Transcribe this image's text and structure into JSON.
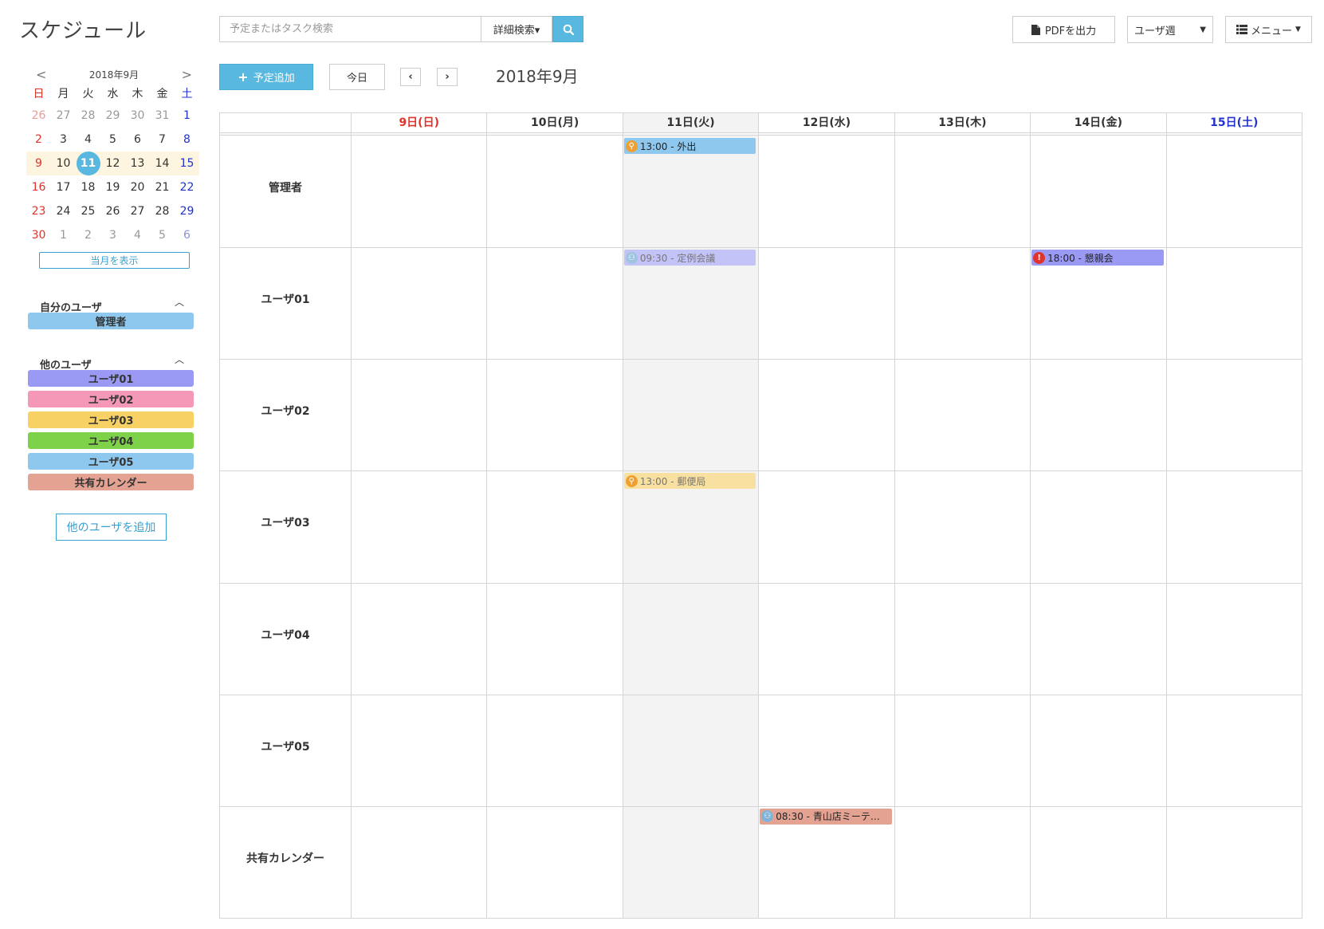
{
  "app": {
    "title": "スケジュール"
  },
  "search": {
    "placeholder": "予定またはタスク検索",
    "advanced_label": "詳細検索▾"
  },
  "toolbar": {
    "pdf_label": "PDFを出力",
    "view_selected": "ユーザ週",
    "menu_label": "メニュー",
    "add_label": "予定追加",
    "today_label": "今日",
    "prev_label": "‹",
    "next_label": "›",
    "current_month": "2018年9月"
  },
  "mini_calendar": {
    "title": "2018年9月",
    "prev": "<",
    "next": ">",
    "weekdays": [
      "日",
      "月",
      "火",
      "水",
      "木",
      "金",
      "土"
    ],
    "weeks": [
      [
        "26",
        "27",
        "28",
        "29",
        "30",
        "31",
        "1"
      ],
      [
        "2",
        "3",
        "4",
        "5",
        "6",
        "7",
        "8"
      ],
      [
        "9",
        "10",
        "11",
        "12",
        "13",
        "14",
        "15"
      ],
      [
        "16",
        "17",
        "18",
        "19",
        "20",
        "21",
        "22"
      ],
      [
        "23",
        "24",
        "25",
        "26",
        "27",
        "28",
        "29"
      ],
      [
        "30",
        "1",
        "2",
        "3",
        "4",
        "5",
        "6"
      ]
    ],
    "today": "11",
    "show_month_label": "当月を表示"
  },
  "my_users": {
    "title": "自分のユーザ",
    "items": [
      {
        "label": "管理者",
        "color": "#8ec8ee"
      }
    ]
  },
  "other_users": {
    "title": "他のユーザ",
    "items": [
      {
        "label": "ユーザ01",
        "color": "#9a9af5"
      },
      {
        "label": "ユーザ02",
        "color": "#f598b8"
      },
      {
        "label": "ユーザ03",
        "color": "#f8d164"
      },
      {
        "label": "ユーザ04",
        "color": "#7ed24a"
      },
      {
        "label": "ユーザ05",
        "color": "#8ec8ee"
      },
      {
        "label": "共有カレンダー",
        "color": "#e4a392"
      }
    ],
    "add_label": "他のユーザを追加"
  },
  "week": {
    "days": [
      {
        "label": "9日(日)",
        "kind": "sun"
      },
      {
        "label": "10日(月)",
        "kind": ""
      },
      {
        "label": "11日(火)",
        "kind": "tue"
      },
      {
        "label": "12日(水)",
        "kind": ""
      },
      {
        "label": "13日(木)",
        "kind": ""
      },
      {
        "label": "14日(金)",
        "kind": ""
      },
      {
        "label": "15日(土)",
        "kind": "sat"
      }
    ],
    "rows": [
      "管理者",
      "ユーザ01",
      "ユーザ02",
      "ユーザ03",
      "ユーザ04",
      "ユーザ05",
      "共有カレンダー"
    ],
    "events": [
      {
        "row": 0,
        "day": 2,
        "text": "13:00 - 外出",
        "icon": "walking-icon",
        "color": "#8ec8ee",
        "icon_color": "#f0a030",
        "faded": false
      },
      {
        "row": 1,
        "day": 2,
        "text": "09:30 - 定例会議",
        "icon": "meeting-icon",
        "color": "#c3c3f7",
        "icon_color": "#9fc4e0",
        "faded": true
      },
      {
        "row": 1,
        "day": 5,
        "text": "18:00 - 懇親会",
        "icon": "alert-icon",
        "color": "#9a9af5",
        "icon_color": "#e0332c",
        "faded": false
      },
      {
        "row": 3,
        "day": 2,
        "text": "13:00 - 郵便局",
        "icon": "walking-icon",
        "color": "#f8e0a0",
        "icon_color": "#f0a030",
        "faded": true
      },
      {
        "row": 6,
        "day": 3,
        "text": "08:30 - 青山店ミーテ…",
        "icon": "meeting-icon",
        "color": "#e4a392",
        "icon_color": "#7fb4d8",
        "faded": false
      }
    ]
  }
}
